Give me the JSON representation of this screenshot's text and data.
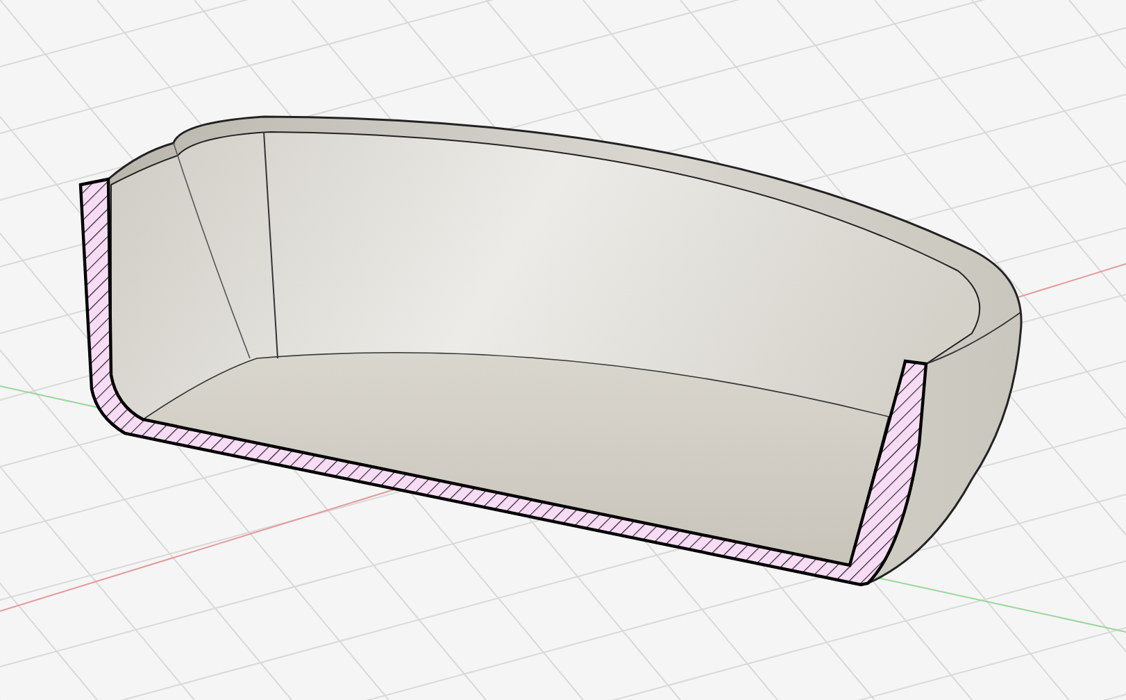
{
  "viewport": {
    "grid": true,
    "axes": true
  }
}
